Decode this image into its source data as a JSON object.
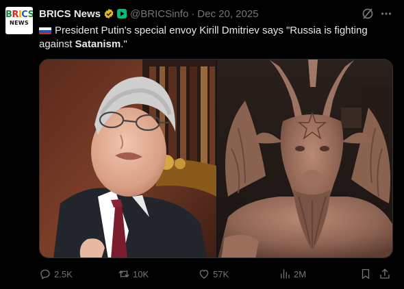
{
  "account": {
    "avatar_text_top": [
      "B",
      "R",
      "I",
      "C",
      "S"
    ],
    "avatar_text_bottom": "NEWS",
    "name": "BRICS News",
    "handle": "@BRICSinfo",
    "date": "Dec 20, 2025"
  },
  "post": {
    "text_part1": "President Putin's special envoy Kirill Dmitriev says \"Russia is fighting against ",
    "text_bold": "Satanism",
    "text_part2": ".\""
  },
  "media": {
    "images": [
      "man-in-suit-photo",
      "goat-headed-statue-photo"
    ]
  },
  "actions": {
    "replies": "2.5K",
    "reposts": "10K",
    "likes": "57K",
    "views": "2M"
  },
  "colors": {
    "background": "#000000",
    "text": "#e7e9ea",
    "muted": "#71767b",
    "verified_gold": "#e2b719",
    "affiliate_green": "#00ba7c"
  }
}
